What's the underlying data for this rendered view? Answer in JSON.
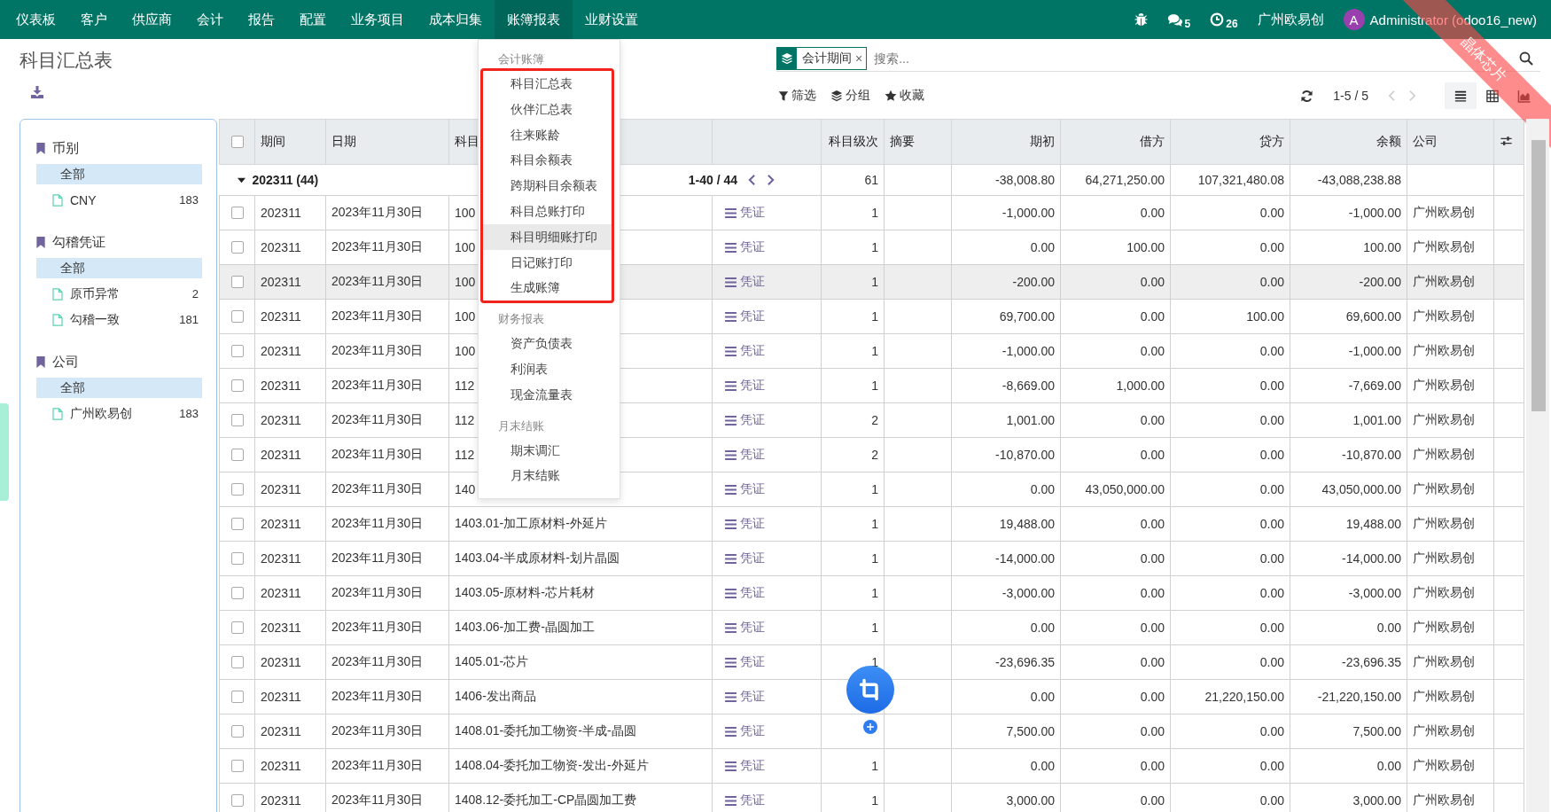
{
  "navbar": {
    "menus": [
      {
        "label": "仪表板",
        "selected": false
      },
      {
        "label": "客户",
        "selected": false
      },
      {
        "label": "供应商",
        "selected": false
      },
      {
        "label": "会计",
        "selected": false
      },
      {
        "label": "报告",
        "selected": false
      },
      {
        "label": "配置",
        "selected": false
      },
      {
        "label": "业务项目",
        "selected": false
      },
      {
        "label": "成本归集",
        "selected": false
      },
      {
        "label": "账簿报表",
        "selected": true
      },
      {
        "label": "业财设置",
        "selected": false
      }
    ],
    "messages_count": "5",
    "activities_count": "26",
    "company": "广州欧易创",
    "user": {
      "initial": "A",
      "name": "Administrator (odoo16_new)"
    }
  },
  "ribbon": {
    "text": "晶体芯片"
  },
  "page": {
    "title": "科目汇总表"
  },
  "search": {
    "facet": "会计期间",
    "facet_remove": "×",
    "placeholder": "搜索..."
  },
  "toolbar": {
    "filter": "筛选",
    "group_by": "分组",
    "favorites": "收藏",
    "pager": "1-5 / 5",
    "views": [
      {
        "kind": "list",
        "selected": true
      },
      {
        "kind": "pivot",
        "selected": false
      },
      {
        "kind": "graph",
        "selected": false
      }
    ]
  },
  "sidebar": {
    "sections": [
      {
        "title": "币别",
        "items": [
          {
            "label": "全部",
            "selected": true
          },
          {
            "label": "CNY",
            "count": "183",
            "selected": false
          }
        ]
      },
      {
        "title": "勾稽凭证",
        "items": [
          {
            "label": "全部",
            "selected": true
          },
          {
            "label": "原币异常",
            "count": "2",
            "selected": false
          },
          {
            "label": "勾稽一致",
            "count": "181",
            "selected": false
          }
        ]
      },
      {
        "title": "公司",
        "items": [
          {
            "label": "全部",
            "selected": true
          },
          {
            "label": "广州欧易创",
            "count": "183",
            "selected": false
          }
        ]
      }
    ]
  },
  "dropdown": {
    "groups": [
      {
        "title": "会计账簿",
        "framed": true,
        "items": [
          {
            "label": "科目汇总表",
            "selected": false
          },
          {
            "label": "伙伴汇总表",
            "selected": false
          },
          {
            "label": "往来账龄",
            "selected": false
          },
          {
            "label": "科目余额表",
            "selected": false
          },
          {
            "label": "跨期科目余额表",
            "selected": false
          },
          {
            "label": "科目总账打印",
            "selected": false
          },
          {
            "label": "科目明细账打印",
            "selected": true
          },
          {
            "label": "日记账打印",
            "selected": false
          },
          {
            "label": "生成账簿",
            "selected": false
          }
        ]
      },
      {
        "title": "财务报表",
        "framed": false,
        "items": [
          {
            "label": "资产负债表",
            "selected": false
          },
          {
            "label": "利润表",
            "selected": false
          },
          {
            "label": "现金流量表",
            "selected": false
          }
        ]
      },
      {
        "title": "月末结账",
        "framed": false,
        "items": [
          {
            "label": "期末调汇",
            "selected": false
          },
          {
            "label": "月末结账",
            "selected": false
          }
        ]
      }
    ]
  },
  "table": {
    "select_all_checked": false,
    "headers": {
      "period": "期间",
      "date": "日期",
      "account": "科目",
      "grade": "科目级次",
      "summary": "摘要",
      "opening": "期初",
      "debit": "借方",
      "credit": "贷方",
      "balance": "余额",
      "company": "公司"
    },
    "group": {
      "label": "202311 (44)",
      "expanded": true,
      "pager": "1-40 / 44",
      "grade": "61",
      "opening": "-38,008.80",
      "debit": "64,271,250.00",
      "credit": "107,321,480.08",
      "balance": "-43,088,238.88"
    },
    "rows": [
      {
        "checked": false,
        "highlighted": false,
        "period": "202311",
        "date": "2023年11月30日",
        "account": "100",
        "voucher": "凭证",
        "grade": "1",
        "opening": "-1,000.00",
        "debit": "0.00",
        "credit": "0.00",
        "balance": "-1,000.00",
        "company": "广州欧易创"
      },
      {
        "checked": false,
        "highlighted": false,
        "period": "202311",
        "date": "2023年11月30日",
        "account": "100",
        "voucher": "凭证",
        "grade": "1",
        "opening": "0.00",
        "debit": "100.00",
        "credit": "0.00",
        "balance": "100.00",
        "company": "广州欧易创"
      },
      {
        "checked": false,
        "highlighted": true,
        "period": "202311",
        "date": "2023年11月30日",
        "account": "100",
        "voucher": "凭证",
        "grade": "1",
        "opening": "-200.00",
        "debit": "0.00",
        "credit": "0.00",
        "balance": "-200.00",
        "company": "广州欧易创"
      },
      {
        "checked": false,
        "highlighted": false,
        "period": "202311",
        "date": "2023年11月30日",
        "account": "100",
        "voucher": "凭证",
        "grade": "1",
        "opening": "69,700.00",
        "debit": "0.00",
        "credit": "100.00",
        "balance": "69,600.00",
        "company": "广州欧易创"
      },
      {
        "checked": false,
        "highlighted": false,
        "period": "202311",
        "date": "2023年11月30日",
        "account": "100",
        "voucher": "凭证",
        "grade": "1",
        "opening": "-1,000.00",
        "debit": "0.00",
        "credit": "0.00",
        "balance": "-1,000.00",
        "company": "广州欧易创"
      },
      {
        "checked": false,
        "highlighted": false,
        "period": "202311",
        "date": "2023年11月30日",
        "account": "112",
        "voucher": "凭证",
        "grade": "1",
        "opening": "-8,669.00",
        "debit": "1,000.00",
        "credit": "0.00",
        "balance": "-7,669.00",
        "company": "广州欧易创"
      },
      {
        "checked": false,
        "highlighted": false,
        "period": "202311",
        "date": "2023年11月30日",
        "account": "112",
        "voucher": "凭证",
        "grade": "2",
        "opening": "1,001.00",
        "debit": "0.00",
        "credit": "0.00",
        "balance": "1,001.00",
        "company": "广州欧易创"
      },
      {
        "checked": false,
        "highlighted": false,
        "period": "202311",
        "date": "2023年11月30日",
        "account": "112",
        "voucher": "凭证",
        "grade": "2",
        "opening": "-10,870.00",
        "debit": "0.00",
        "credit": "0.00",
        "balance": "-10,870.00",
        "company": "广州欧易创"
      },
      {
        "checked": false,
        "highlighted": false,
        "period": "202311",
        "date": "2023年11月30日",
        "account": "140",
        "voucher": "凭证",
        "grade": "1",
        "opening": "0.00",
        "debit": "43,050,000.00",
        "credit": "0.00",
        "balance": "43,050,000.00",
        "company": "广州欧易创"
      },
      {
        "checked": false,
        "highlighted": false,
        "period": "202311",
        "date": "2023年11月30日",
        "account": "1403.01-加工原材料-外延片",
        "voucher": "凭证",
        "grade": "1",
        "opening": "19,488.00",
        "debit": "0.00",
        "credit": "0.00",
        "balance": "19,488.00",
        "company": "广州欧易创"
      },
      {
        "checked": false,
        "highlighted": false,
        "period": "202311",
        "date": "2023年11月30日",
        "account": "1403.04-半成原材料-划片晶圆",
        "voucher": "凭证",
        "grade": "1",
        "opening": "-14,000.00",
        "debit": "0.00",
        "credit": "0.00",
        "balance": "-14,000.00",
        "company": "广州欧易创"
      },
      {
        "checked": false,
        "highlighted": false,
        "period": "202311",
        "date": "2023年11月30日",
        "account": "1403.05-原材料-芯片耗材",
        "voucher": "凭证",
        "grade": "1",
        "opening": "-3,000.00",
        "debit": "0.00",
        "credit": "0.00",
        "balance": "-3,000.00",
        "company": "广州欧易创"
      },
      {
        "checked": false,
        "highlighted": false,
        "period": "202311",
        "date": "2023年11月30日",
        "account": "1403.06-加工费-晶圆加工",
        "voucher": "凭证",
        "grade": "1",
        "opening": "0.00",
        "debit": "0.00",
        "credit": "0.00",
        "balance": "0.00",
        "company": "广州欧易创"
      },
      {
        "checked": false,
        "highlighted": false,
        "period": "202311",
        "date": "2023年11月30日",
        "account": "1405.01-芯片",
        "voucher": "凭证",
        "grade": "1",
        "opening": "-23,696.35",
        "debit": "0.00",
        "credit": "0.00",
        "balance": "-23,696.35",
        "company": "广州欧易创"
      },
      {
        "checked": false,
        "highlighted": false,
        "period": "202311",
        "date": "2023年11月30日",
        "account": "1406-发出商品",
        "voucher": "凭证",
        "opening": "0.00",
        "debit": "0.00",
        "credit": "21,220,150.00",
        "balance": "-21,220,150.00",
        "company": "广州欧易创"
      },
      {
        "checked": false,
        "highlighted": false,
        "period": "202311",
        "date": "2023年11月30日",
        "account": "1408.01-委托加工物资-半成-晶圆",
        "voucher": "凭证",
        "opening": "7,500.00",
        "debit": "0.00",
        "credit": "0.00",
        "balance": "7,500.00",
        "company": "广州欧易创"
      },
      {
        "checked": false,
        "highlighted": false,
        "period": "202311",
        "date": "2023年11月30日",
        "account": "1408.04-委托加工物资-发出-外延片",
        "voucher": "凭证",
        "grade": "1",
        "opening": "0.00",
        "debit": "0.00",
        "credit": "0.00",
        "balance": "0.00",
        "company": "广州欧易创"
      },
      {
        "checked": false,
        "highlighted": false,
        "period": "202311",
        "date": "2023年11月30日",
        "account": "1408.12-委托加工-CP晶圆加工费",
        "voucher": "凭证",
        "grade": "1",
        "opening": "3,000.00",
        "debit": "0.00",
        "credit": "0.00",
        "balance": "3,000.00",
        "company": "广州欧易创"
      }
    ]
  }
}
